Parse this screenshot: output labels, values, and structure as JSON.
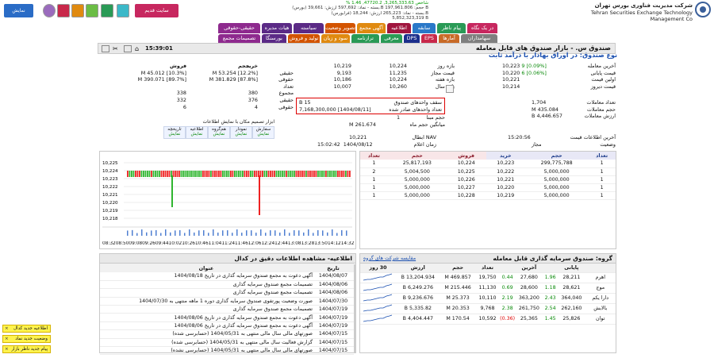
{
  "header": {
    "company_fa": "شرکت مدیریت فناوری بورس تهران",
    "company_en": "Tehran Securities Exchange Technology Management Co",
    "index_lines": [
      "% 1.46 ,47720.2 ,3,265,333.63 شاخص",
      "(بورس) بسته - نماد: 597,692 ارزش: 39,661.B حجم: 197,961.806 B",
      "(فرابورس) بسته - نماد: 265,223 ارزش: 18,244.B",
      "5,852,323,319 B"
    ],
    "old_site_btn": "سایت قدیم",
    "show_list_btn": "نمایش فهرست"
  },
  "tabs_top": [
    {
      "label": "دیدبان بورس",
      "color": "#4b4b4b"
    },
    {
      "label": "ام کپیتال",
      "color": "#c8284a"
    },
    {
      "label": "EPS",
      "color": "#c8284a"
    },
    {
      "label": "DPS",
      "color": "#1c2f8c"
    },
    {
      "label": "آمارها",
      "color": "#c86b28"
    }
  ],
  "tabs_row1": [
    {
      "label": "در یک نگاه",
      "color": "#c7275f"
    },
    {
      "label": "پیام ناظر",
      "color": "#2a9a56"
    },
    {
      "label": "سابقه",
      "color": "#2a78c8"
    },
    {
      "label": "اطلاعیه",
      "color": "#a0153e"
    },
    {
      "label": "آگهی مجمع",
      "color": "#e08a10"
    },
    {
      "label": "تصویر وضعیت",
      "color": "#d35400"
    },
    {
      "label": "سیاسته",
      "color": "#5b2a86"
    },
    {
      "label": "هیات مدیره",
      "color": "#5b2a86"
    },
    {
      "label": "حقیقی-حقوقی",
      "color": "#8e2a8e"
    }
  ],
  "tabs_row2": [
    {
      "label": "سهامداران",
      "color": "#7f7f7f"
    },
    {
      "label": "معرفی",
      "color": "#2a9a56"
    },
    {
      "label": "ترازنامه",
      "color": "#2a9a56"
    },
    {
      "label": "سود و زیان",
      "color": "#e08a10"
    },
    {
      "label": "تولید و فروش",
      "color": "#d35400"
    },
    {
      "label": "بورسنگا",
      "color": "#5b2a86"
    },
    {
      "label": "تصمیمات مجمع",
      "color": "#8e2a8e"
    }
  ],
  "symbol": {
    "title": "صندوق س. - بازار صندوق های قابل معامله",
    "subtitle": "نوع صندوق: در اوراق بهادار با درآمد ثابت",
    "time": "15:39:01"
  },
  "prices": [
    {
      "label": "آخرین معامله",
      "value": "10,223",
      "change": "9",
      "pct": "[0.09%]"
    },
    {
      "label": "قیمت پایانی",
      "value": "10,220",
      "change": "6",
      "pct": "[0.06%]"
    },
    {
      "label": "اولین قیمت",
      "value": "10,221",
      "change": "",
      "pct": ""
    },
    {
      "label": "قیمت دیروز",
      "value": "10,214",
      "change": "",
      "pct": ""
    }
  ],
  "ranges": [
    {
      "label": "بازه روز",
      "low": "10,224",
      "high": "10,219"
    },
    {
      "label": "قیمت مجاز",
      "low": "11,235",
      "high": "9,193"
    },
    {
      "label": "بازه هفته",
      "low": "10,224",
      "high": "10,186"
    },
    {
      "label": "بازه سال",
      "low": "10,260",
      "high": "10,007"
    }
  ],
  "trade_stats": [
    {
      "label": "تعداد معاملات",
      "value": "1,704"
    },
    {
      "label": "حجم معاملات",
      "value": "435.084 M"
    },
    {
      "label": "ارزش معاملات",
      "value": "4,446.657 B"
    }
  ],
  "fund_box": [
    {
      "label": "سقف واحدهای صندوق",
      "value": "15 B"
    },
    {
      "label": "تعداد واحدهای صادر شده",
      "value": "[1404/08/11] 7,168,300,000"
    }
  ],
  "base_vol": {
    "label": "حجم مبنا",
    "value": "1"
  },
  "avg_month": {
    "label": "میانگین حجم ماه",
    "value": "261.674 M"
  },
  "last_info": {
    "label": "آخرین اطلاعات قیمت",
    "value": "15:20:56"
  },
  "status": {
    "label": "وضعیت",
    "value": "مجاز"
  },
  "nav": {
    "label": "NAV ابطال",
    "value": "10,221"
  },
  "nav_time": {
    "label": "زمان اعلام",
    "date": "1404/08/12",
    "time": "15:02:42"
  },
  "hq": {
    "headers": [
      "",
      "خرید",
      "فروش"
    ],
    "rows": [
      {
        "label": "حجم",
        "buy": "",
        "sell": ""
      },
      {
        "label": "حقیقی",
        "buy": "53.254 M",
        "buy_pct": "[12.2%]",
        "sell": "45.012 M",
        "sell_pct": "[10.3%]"
      },
      {
        "label": "حقوقی",
        "buy": "381.829 M",
        "buy_pct": "[87.8%]",
        "sell": "390.071 M",
        "sell_pct": "[89.7%]"
      },
      {
        "label": "تعداد",
        "buy": "",
        "sell": ""
      },
      {
        "label": "مجموع",
        "buy": "380",
        "sell": "338"
      },
      {
        "label": "حقیقی",
        "buy": "376",
        "sell": "332"
      },
      {
        "label": "حقوقی",
        "buy": "4",
        "sell": "6"
      }
    ]
  },
  "tools": {
    "caption": "ابزار تصمیم مکان با نمایش اطلاعات",
    "items": [
      "سفارش",
      "نمودار",
      "هم‌گروه",
      "اطلاعیه",
      "تاریخچه"
    ],
    "show": "نمایش"
  },
  "orderbook": {
    "headers": [
      "تعداد",
      "حجم",
      "خرید",
      "فروش",
      "حجم",
      "تعداد"
    ],
    "rows": [
      [
        "1",
        "299,775,788",
        "10,223",
        "10,224",
        "25,817,193",
        "1"
      ],
      [
        "1",
        "5,000,000",
        "10,222",
        "10,225",
        "5,004,500",
        "2"
      ],
      [
        "1",
        "5,000,000",
        "10,221",
        "10,226",
        "5,000,000",
        "1"
      ],
      [
        "1",
        "5,000,000",
        "10,220",
        "10,227",
        "5,000,000",
        "1"
      ],
      [
        "1",
        "5,000,000",
        "10,219",
        "10,228",
        "5,000,000",
        "1"
      ]
    ]
  },
  "intraday": {
    "y_ticks": [
      "10,225",
      "10,224",
      "10,223",
      "10,222",
      "10,221",
      "10,220",
      "10,219",
      "10,218"
    ],
    "x_label": "08:3208:5009:0809:2609:4410:0210:2610:4611:0411:2411:4612:0612:2412:4413:0813:2813:5014:1214:3214:54"
  },
  "group": {
    "title": "گروه: صندوق سرمایه گذاری قابل معامله",
    "compare_link": "مقایسه شرکت های گروه",
    "headers": [
      "",
      "پایانی",
      "",
      "آخرین",
      "",
      "تعداد",
      "حجم",
      "ارزش",
      "30 روز"
    ],
    "rows": [
      {
        "name": "اهرم",
        "close": "28,211",
        "cchg": "1.96",
        "last": "27,680",
        "lchg": "0.44",
        "count": "19,750",
        "vol": "469.857 M",
        "val": "13,204.934 B"
      },
      {
        "name": "موج",
        "close": "28,621",
        "cchg": "1.18",
        "last": "28,600",
        "lchg": "0.69",
        "count": "11,130",
        "vol": "215.446 M",
        "val": "6,249.276 B"
      },
      {
        "name": "دارا یکم",
        "close": "364,040",
        "cchg": "2.43",
        "last": "363,200",
        "lchg": "2.19",
        "count": "10,110",
        "vol": "25.373 M",
        "val": "9,236.676 B"
      },
      {
        "name": "بالابش",
        "close": "262,160",
        "cchg": "2.54",
        "last": "261,750",
        "lchg": "2.38",
        "count": "9,768",
        "vol": "20.353 M",
        "val": "5,335.82 B"
      },
      {
        "name": "توان",
        "close": "25,826",
        "cchg": "1.45",
        "last": "25,365",
        "lchg": "(0.36)",
        "count": "10,592",
        "vol": "170.54 M",
        "val": "4,404.447 B"
      }
    ]
  },
  "news": {
    "title": "اطلاعیه- مشاهده اطلاعات دقیق در کدال",
    "headers": [
      "تاریخ",
      "عنوان"
    ],
    "rows": [
      {
        "date": "1404/08/07",
        "text": "آگهی دعوت به مجمع صندوق سرمایه گذاری در تاریخ 1404/08/18"
      },
      {
        "date": "1404/08/06",
        "text": "تصمیمات مجمع صندوق سرمایه گذاری"
      },
      {
        "date": "1404/08/06",
        "text": "تصمیمات مجمع صندوق سرمایه گذاری"
      },
      {
        "date": "1404/07/30",
        "text": "صورت وضعیت پورتفوی صندوق سرمایه گذاری دوره 1 ماهه منتهی به 1404/07/30"
      },
      {
        "date": "1404/07/19",
        "text": "تصمیمات مجمع صندوق سرمایه گذاری"
      },
      {
        "date": "1404/07/19",
        "text": "آگهی دعوت به مجمع صندوق سرمایه گذاری در تاریخ 1404/08/06"
      },
      {
        "date": "1404/07/19",
        "text": "آگهی دعوت به مجمع صندوق سرمایه گذاری در تاریخ 1404/08/06"
      },
      {
        "date": "1404/07/15",
        "text": "صورتهای مالی سال مالی منتهی به 1404/05/31 (حسابرسی شده)"
      },
      {
        "date": "1404/07/15",
        "text": "گزارش فعالیت سال مالی منتهی به 1404/05/31 (حسابرسی شده)"
      },
      {
        "date": "1404/07/15",
        "text": "صورتهای مالی سال مالی منتهی به 1404/05/31 (حسابرسی نشده)"
      }
    ]
  },
  "alerts": [
    "اطلاعیه جدید کدال",
    "وضعیت جدید نماد",
    "پیام جدید ناظر بازار"
  ],
  "colors": {
    "green": "#0a8a0a",
    "red": "#dd0000",
    "blue": "#1a4fb0"
  }
}
